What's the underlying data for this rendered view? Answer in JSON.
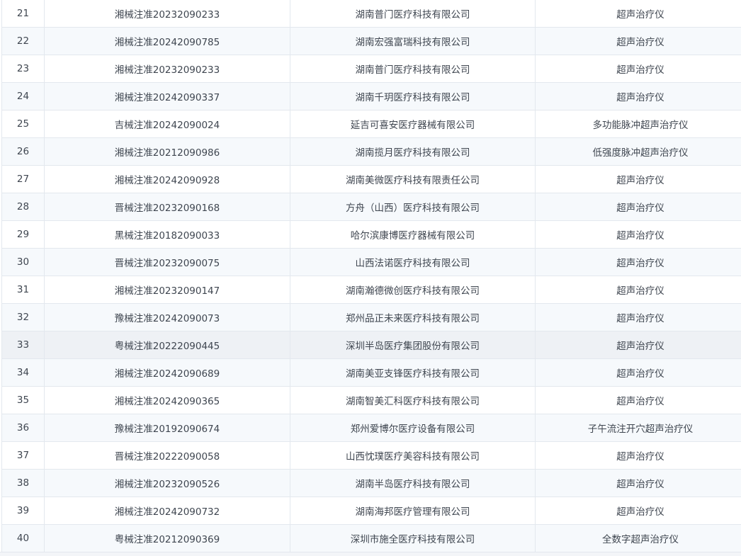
{
  "table": {
    "rows": [
      {
        "index": "21",
        "reg_no": "湘械注准20232090233",
        "company": "湖南普门医疗科技有限公司",
        "product": "超声治疗仪"
      },
      {
        "index": "22",
        "reg_no": "湘械注准20242090785",
        "company": "湖南宏强富瑞科技有限公司",
        "product": "超声治疗仪"
      },
      {
        "index": "23",
        "reg_no": "湘械注准20232090233",
        "company": "湖南普门医疗科技有限公司",
        "product": "超声治疗仪"
      },
      {
        "index": "24",
        "reg_no": "湘械注准20242090337",
        "company": "湖南千玥医疗科技有限公司",
        "product": "超声治疗仪"
      },
      {
        "index": "25",
        "reg_no": "吉械注准20242090024",
        "company": "延吉可喜安医疗器械有限公司",
        "product": "多功能脉冲超声治疗仪"
      },
      {
        "index": "26",
        "reg_no": "湘械注准20212090986",
        "company": "湖南揽月医疗科技有限公司",
        "product": "低强度脉冲超声治疗仪"
      },
      {
        "index": "27",
        "reg_no": "湘械注准20242090928",
        "company": "湖南美微医疗科技有限责任公司",
        "product": "超声治疗仪"
      },
      {
        "index": "28",
        "reg_no": "晋械注准20232090168",
        "company": "方舟（山西）医疗科技有限公司",
        "product": "超声治疗仪"
      },
      {
        "index": "29",
        "reg_no": "黑械注准20182090033",
        "company": "哈尔滨康博医疗器械有限公司",
        "product": "超声治疗仪"
      },
      {
        "index": "30",
        "reg_no": "晋械注准20232090075",
        "company": "山西法诺医疗科技有限公司",
        "product": "超声治疗仪"
      },
      {
        "index": "31",
        "reg_no": "湘械注准20232090147",
        "company": "湖南瀚德微创医疗科技有限公司",
        "product": "超声治疗仪"
      },
      {
        "index": "32",
        "reg_no": "豫械注准20242090073",
        "company": "郑州品正未来医疗科技有限公司",
        "product": "超声治疗仪"
      },
      {
        "index": "33",
        "reg_no": "粤械注准20222090445",
        "company": "深圳半岛医疗集团股份有限公司",
        "product": "超声治疗仪"
      },
      {
        "index": "34",
        "reg_no": "湘械注准20242090689",
        "company": "湖南美亚支锋医疗科技有限公司",
        "product": "超声治疗仪"
      },
      {
        "index": "35",
        "reg_no": "湘械注准20242090365",
        "company": "湖南智美汇科医疗科技有限公司",
        "product": "超声治疗仪"
      },
      {
        "index": "36",
        "reg_no": "豫械注准20192090674",
        "company": "郑州爱博尔医疗设备有限公司",
        "product": "子午流注开穴超声治疗仪"
      },
      {
        "index": "37",
        "reg_no": "晋械注准20222090058",
        "company": "山西忱璞医疗美容科技有限公司",
        "product": "超声治疗仪"
      },
      {
        "index": "38",
        "reg_no": "湘械注准20232090526",
        "company": "湖南半岛医疗科技有限公司",
        "product": "超声治疗仪"
      },
      {
        "index": "39",
        "reg_no": "湘械注准20242090732",
        "company": "湖南海邦医疗管理有限公司",
        "product": "超声治疗仪"
      },
      {
        "index": "40",
        "reg_no": "粤械注准20212090369",
        "company": "深圳市施全医疗科技有限公司",
        "product": "全数字超声治疗仪"
      }
    ],
    "highlighted_row_index": "33"
  },
  "colors": {
    "border": "#e3e8ee",
    "row_stripe": "#f6f9fc",
    "row_highlight": "#eef1f5",
    "text": "#3f4650"
  }
}
